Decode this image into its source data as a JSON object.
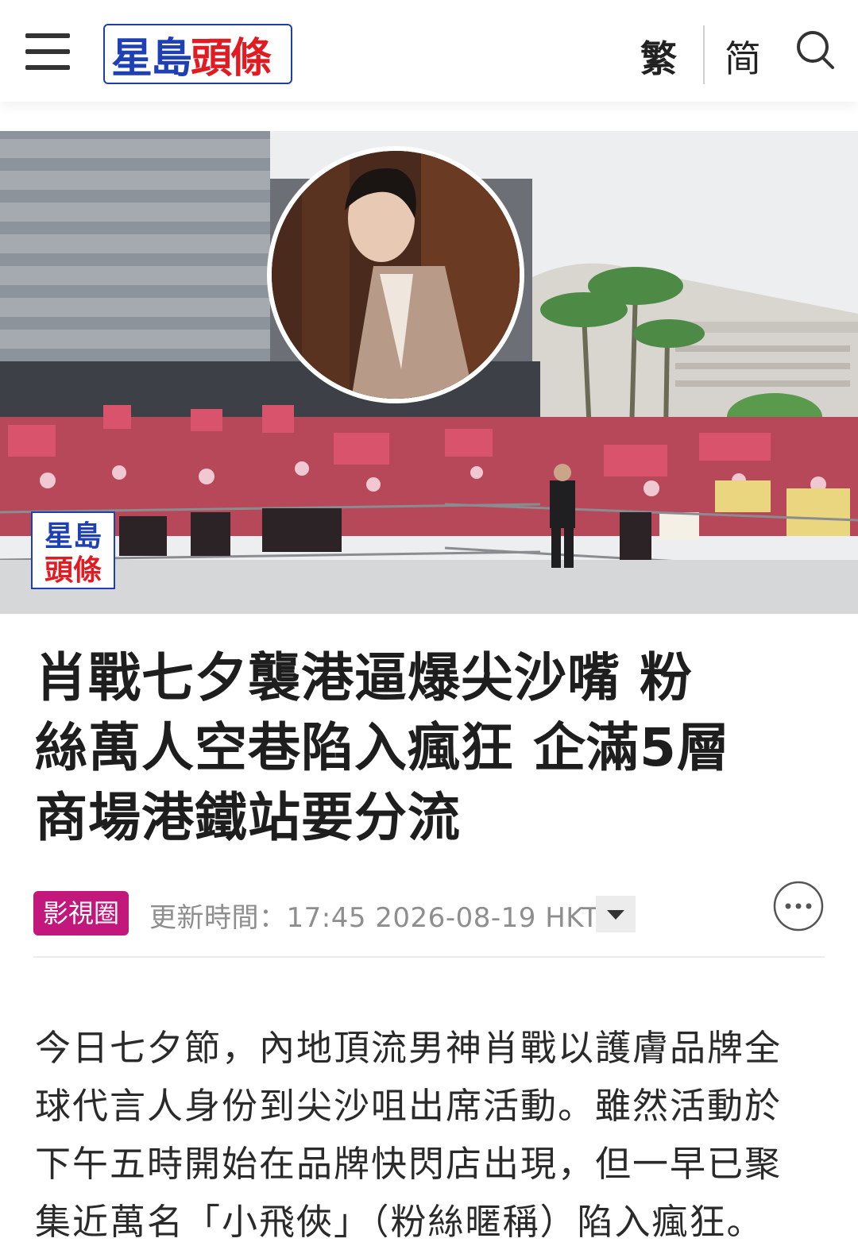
{
  "header": {
    "logo_part1": "星島",
    "logo_part2": "頭條",
    "lang_traditional": "繁",
    "lang_simplified": "简"
  },
  "hero": {
    "watermark_part1": "星島",
    "watermark_part2": "頭條"
  },
  "article": {
    "title_line1": "肖戰七夕襲港逼爆尖沙嘴 粉",
    "title_line2": "絲萬人空巷陷入瘋狂 企滿5層",
    "title_line3": "商場港鐵站要分流",
    "category": "影視圈",
    "update_label": "更新時間：",
    "update_time": "17:45 2026-08-19 HKT",
    "body_line1": "今日七夕節，內地頂流男神肖戰以護膚品牌全",
    "body_line2": "球代言人身份到尖沙咀出席活動。雖然活動於",
    "body_line3": "下午五時開始在品牌快閃店出現，但一早已聚",
    "body_line4": "集近萬名「小飛俠」（粉絲暱稱）陷入瘋狂。"
  },
  "colors": {
    "logo_blue": "#1e40b4",
    "logo_red": "#e21b23",
    "category_badge": "#c2177b"
  },
  "icons": [
    "menu-icon",
    "search-icon",
    "chevron-down-icon",
    "more-icon"
  ]
}
